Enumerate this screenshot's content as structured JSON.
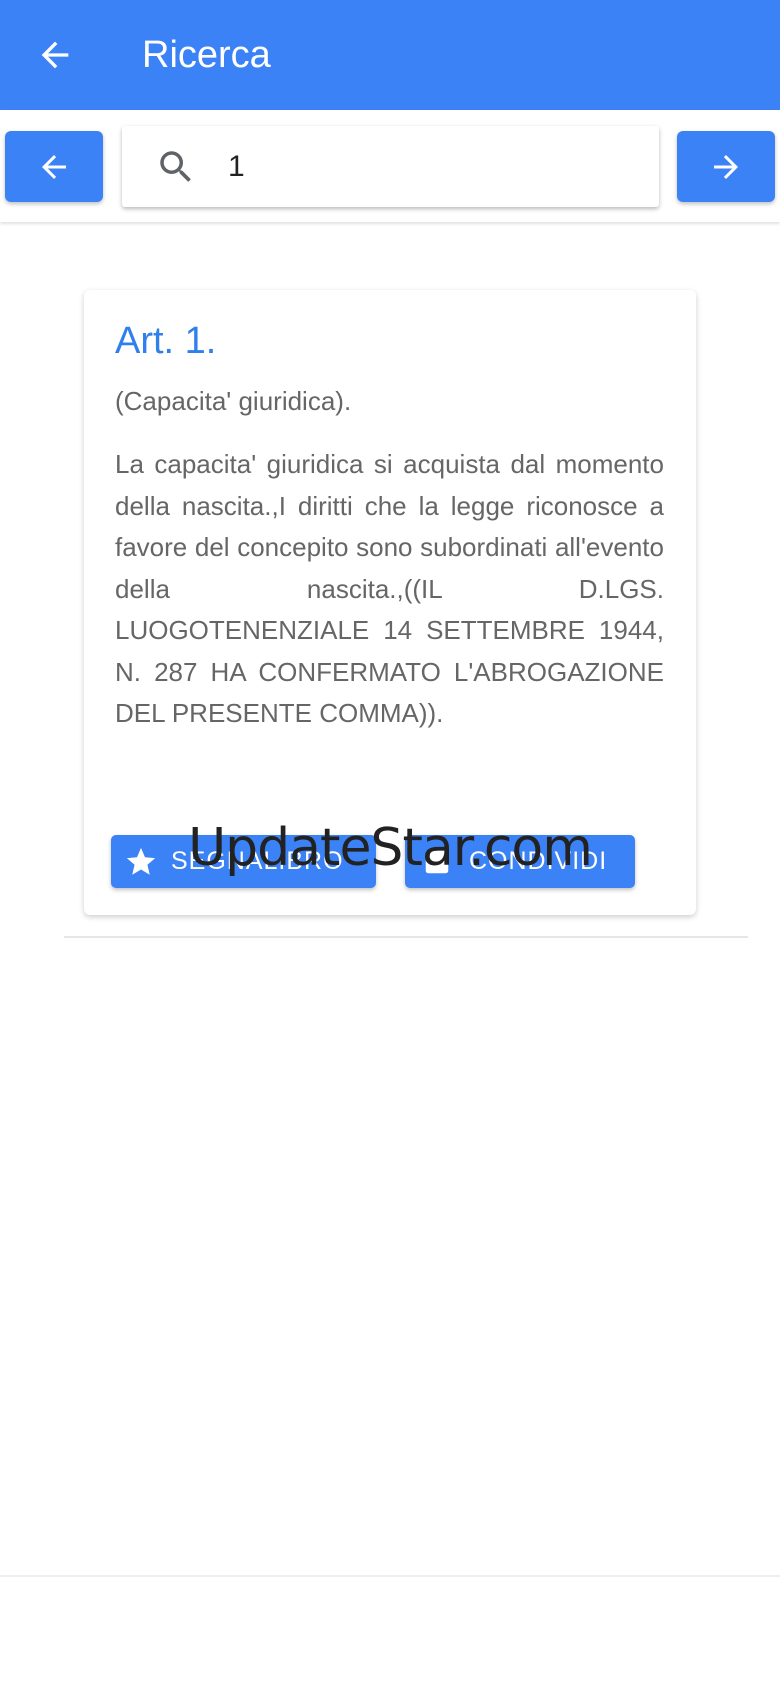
{
  "app_bar": {
    "title": "Ricerca",
    "back_icon": "arrow-left-icon",
    "color": "#3b82f6"
  },
  "search": {
    "value": "1",
    "icon": "search-icon",
    "prev_icon": "arrow-left-icon",
    "next_icon": "arrow-right-icon"
  },
  "article": {
    "title": "Art. 1.",
    "subtitle": "(Capacita' giuridica).",
    "body": "La capacita' giuridica si acquista dal momento della nascita.,I diritti che la legge riconosce a favore del concepito sono subordinati all'evento della nascita.,((IL D.LGS. LUOGOTENENZIALE 14 SETTEMBRE 1944, N. 287 HA CONFERMATO L'ABROGAZIONE DEL PRESENTE COMMA)).",
    "title_color": "#2f80ed"
  },
  "actions": {
    "bookmark_label": "SEGNALIBRO",
    "bookmark_icon": "star-icon",
    "share_label": "CONDIVIDI",
    "share_icon": "share-icon"
  },
  "watermark": {
    "text": "UpdateStar.com"
  }
}
